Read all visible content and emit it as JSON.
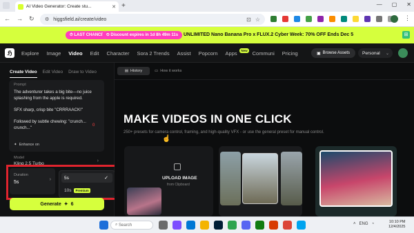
{
  "browser": {
    "tab_title": "AI Video Generator: Create stu...",
    "url": "higgsfield.ai/create/video",
    "window_controls": [
      "—",
      "▢",
      "✕"
    ]
  },
  "banner": {
    "pill_a": "LAST CHANCE",
    "pill_b": "Discount expires in 1d 8h 49m 11s",
    "text": "UNLIMITED Nano Banana Pro x FLUX.2 Cyber Week: 70% OFF Ends Dec 5"
  },
  "nav": {
    "items": [
      "Explore",
      "Image",
      "Video",
      "Edit",
      "Character",
      "Sora 2 Trends",
      "Assist",
      "Popcorn",
      "Apps",
      "Communi",
      "Pricing"
    ],
    "new_badge": "New",
    "browse_assets": "Browse Assets",
    "workspace": "Personal"
  },
  "left": {
    "tabs": [
      "Create Video",
      "Edit Video",
      "Draw to Video"
    ],
    "prompt_label": "Prompt",
    "prompt_p1": "The adventurer takes a big bite—no juice splashing from the apple is required.",
    "prompt_p2": "SFX sharp, crisp bite \"CRRRAACK!\"",
    "prompt_p3": "Followed by subtle chewing: \"crunch... crunch...\"",
    "enhance": "Enhance on",
    "model_label": "Model",
    "model_value": "Kling 2.5 Turbo",
    "duration_label": "Duration",
    "duration_value": "5s",
    "options": [
      "5s",
      "10s"
    ],
    "premium": "Premium",
    "generate": "Generate",
    "generate_cost": "6"
  },
  "main": {
    "history": "History",
    "how_it_works": "How it works",
    "headline": "MAKE VIDEOS IN ONE CLICK",
    "subhead": "250+ presets for camera control, framing, and high-quality VFX - or use the general preset for manual control.",
    "upload_title": "UPLOAD IMAGE",
    "upload_sub": "from Clipboard"
  },
  "taskbar": {
    "search_placeholder": "Search",
    "lang": "ENG",
    "time": "10:10 PM",
    "date": "12/4/2025"
  }
}
